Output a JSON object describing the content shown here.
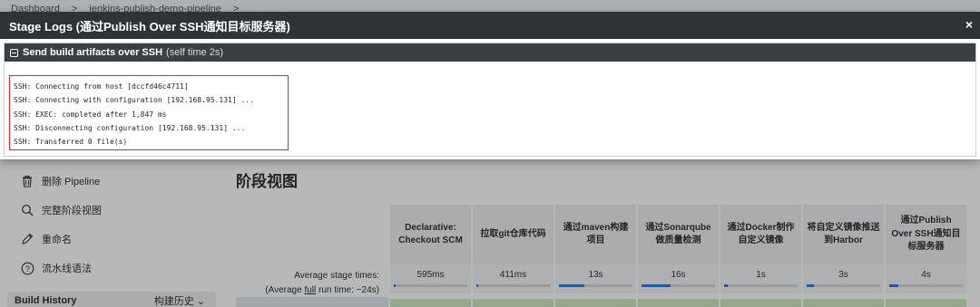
{
  "modal": {
    "title": "Stage Logs (通过Publish Over SSH通知目标服务器)",
    "close_glyph": "×",
    "step": {
      "name": "Send build artifacts over SSH",
      "time": "(self time 2s)"
    },
    "log_lines": [
      "SSH: Connecting from host [dccfd46c4711]",
      "SSH: Connecting with configuration [192.168.95.131] ...",
      "SSH: EXEC: completed after 1,847 ms",
      "SSH: Disconnecting configuration [192.168.95.131] ...",
      "SSH: Transferred 0 file(s)"
    ],
    "highlight_color": "#e8212b"
  },
  "background": {
    "breadcrumb": [
      "Dashboard",
      ">",
      "jenkins-publish-demo-pipeline",
      ">"
    ],
    "sidebar": [
      {
        "label": "删除 Pipeline",
        "icon": "trash-icon"
      },
      {
        "label": "完整阶段视图",
        "icon": "search-icon"
      },
      {
        "label": "重命名",
        "icon": "pencil-icon"
      },
      {
        "label": "流水线语法",
        "icon": "help-icon"
      }
    ],
    "build_history": {
      "label": "Build History",
      "right_label": "构建历史 ⌄"
    },
    "stage_view_title": "阶段视图",
    "avg_label_line1": "Average stage times:",
    "avg_label_line2_prefix": "(Average ",
    "avg_label_link": "full",
    "avg_label_line2_suffix": " run time: ~24s)",
    "stages": [
      {
        "name": "Declarative: Checkout SCM",
        "avg": "595ms",
        "fill": 0.02
      },
      {
        "name": "拉取git仓库代码",
        "avg": "411ms",
        "fill": 0.02
      },
      {
        "name": "通过maven构建项目",
        "avg": "13s",
        "fill": 0.35
      },
      {
        "name": "通过Sonarqube做质量检测",
        "avg": "16s",
        "fill": 0.4
      },
      {
        "name": "通过Docker制作自定义镜像",
        "avg": "1s",
        "fill": 0.05
      },
      {
        "name": "将自定义镜像推送到Harbor",
        "avg": "3s",
        "fill": 0.1
      },
      {
        "name": "通过Publish Over SSH通知目标服务器",
        "avg": "4s",
        "fill": 0.12
      }
    ]
  }
}
